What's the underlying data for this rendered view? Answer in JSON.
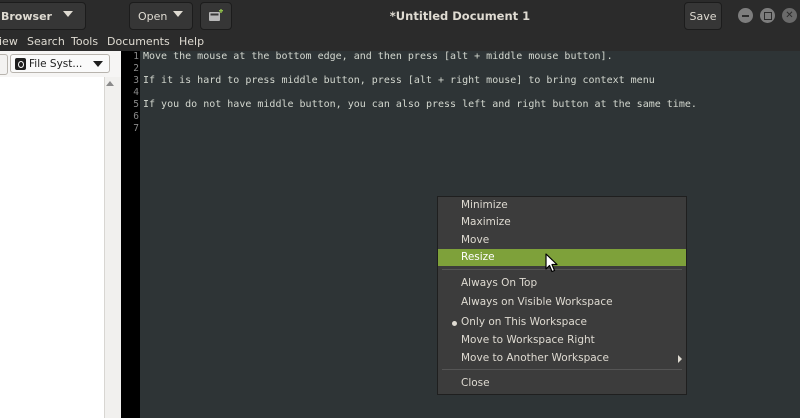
{
  "header": {
    "browser_label": "Browser",
    "open_label": "Open",
    "title": "*Untitled Document 1",
    "save_label": "Save",
    "accent": "#7ea13a"
  },
  "menubar": {
    "items": [
      "iew",
      "Search",
      "Tools",
      "Documents",
      "Help"
    ]
  },
  "side_panel": {
    "combo_label": "File Syst..."
  },
  "editor": {
    "line_numbers": [
      "1",
      "2",
      "3",
      "4",
      "5",
      "6",
      "7"
    ],
    "lines": [
      "Move the mouse at the bottom edge, and then press [alt + middle mouse button].",
      "",
      "If it is hard to press middle button, press [alt + right mouse] to bring context menu",
      "",
      "If you do not have middle button, you can also press left and right button at the same time.",
      "",
      ""
    ]
  },
  "context_menu": {
    "items": [
      {
        "label": "Minimize"
      },
      {
        "label": "Maximize"
      },
      {
        "label": "Move"
      },
      {
        "label": "Resize",
        "highlighted": true
      },
      {
        "label": "Always On Top"
      },
      {
        "label": "Always on Visible Workspace"
      },
      {
        "label": "Only on This Workspace",
        "selected": true
      },
      {
        "label": "Move to Workspace Right"
      },
      {
        "label": "Move to Another Workspace",
        "submenu": true
      },
      {
        "label": "Close"
      }
    ]
  }
}
